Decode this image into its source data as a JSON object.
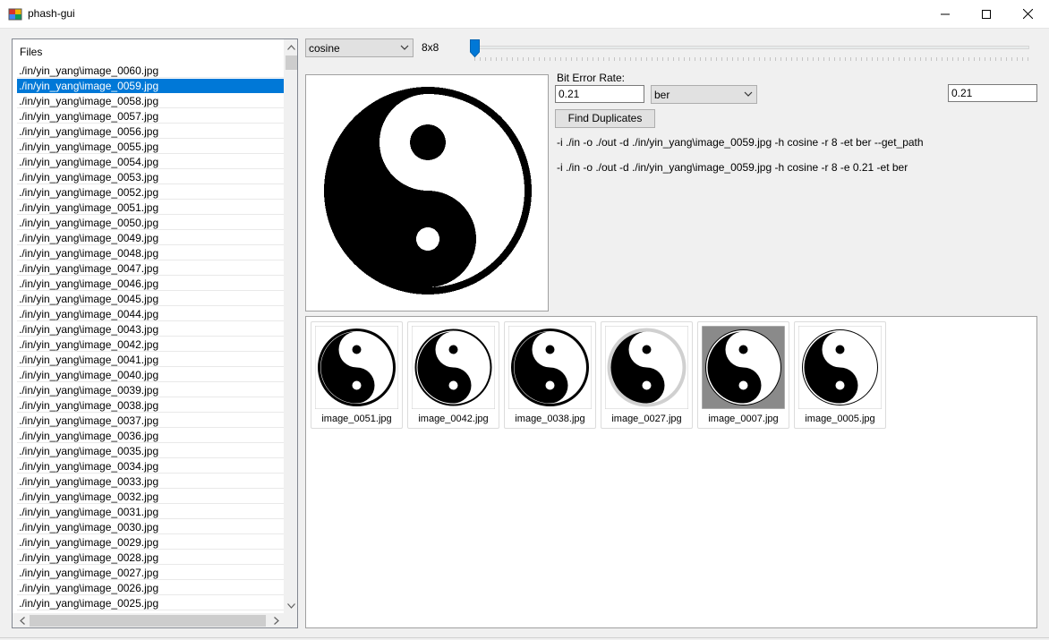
{
  "window": {
    "title": "phash-gui"
  },
  "files": {
    "header": "Files",
    "items": [
      "./in/yin_yang\\image_0060.jpg",
      "./in/yin_yang\\image_0059.jpg",
      "./in/yin_yang\\image_0058.jpg",
      "./in/yin_yang\\image_0057.jpg",
      "./in/yin_yang\\image_0056.jpg",
      "./in/yin_yang\\image_0055.jpg",
      "./in/yin_yang\\image_0054.jpg",
      "./in/yin_yang\\image_0053.jpg",
      "./in/yin_yang\\image_0052.jpg",
      "./in/yin_yang\\image_0051.jpg",
      "./in/yin_yang\\image_0050.jpg",
      "./in/yin_yang\\image_0049.jpg",
      "./in/yin_yang\\image_0048.jpg",
      "./in/yin_yang\\image_0047.jpg",
      "./in/yin_yang\\image_0046.jpg",
      "./in/yin_yang\\image_0045.jpg",
      "./in/yin_yang\\image_0044.jpg",
      "./in/yin_yang\\image_0043.jpg",
      "./in/yin_yang\\image_0042.jpg",
      "./in/yin_yang\\image_0041.jpg",
      "./in/yin_yang\\image_0040.jpg",
      "./in/yin_yang\\image_0039.jpg",
      "./in/yin_yang\\image_0038.jpg",
      "./in/yin_yang\\image_0037.jpg",
      "./in/yin_yang\\image_0036.jpg",
      "./in/yin_yang\\image_0035.jpg",
      "./in/yin_yang\\image_0034.jpg",
      "./in/yin_yang\\image_0033.jpg",
      "./in/yin_yang\\image_0032.jpg",
      "./in/yin_yang\\image_0031.jpg",
      "./in/yin_yang\\image_0030.jpg",
      "./in/yin_yang\\image_0029.jpg",
      "./in/yin_yang\\image_0028.jpg",
      "./in/yin_yang\\image_0027.jpg",
      "./in/yin_yang\\image_0026.jpg",
      "./in/yin_yang\\image_0025.jpg"
    ],
    "selected_index": 1
  },
  "controls": {
    "hash_method": "cosine",
    "hash_size": "8x8",
    "ber_label": "Bit Error Rate:",
    "ber_value": "0.21",
    "metric": "ber",
    "threshold_display": "0.21",
    "find_button": "Find Duplicates",
    "command_1": "-i ./in -o ./out -d ./in/yin_yang\\image_0059.jpg -h cosine -r 8 -et ber --get_path",
    "command_2": "-i ./in -o ./out -d ./in/yin_yang\\image_0059.jpg -h cosine -r 8 -e 0.21 -et ber"
  },
  "results": [
    {
      "name": "image_0051.jpg"
    },
    {
      "name": "image_0042.jpg"
    },
    {
      "name": "image_0038.jpg"
    },
    {
      "name": "image_0027.jpg"
    },
    {
      "name": "image_0007.jpg"
    },
    {
      "name": "image_0005.jpg"
    }
  ],
  "colors": {
    "selection": "#0078d7",
    "slider_thumb": "#0078d7"
  }
}
